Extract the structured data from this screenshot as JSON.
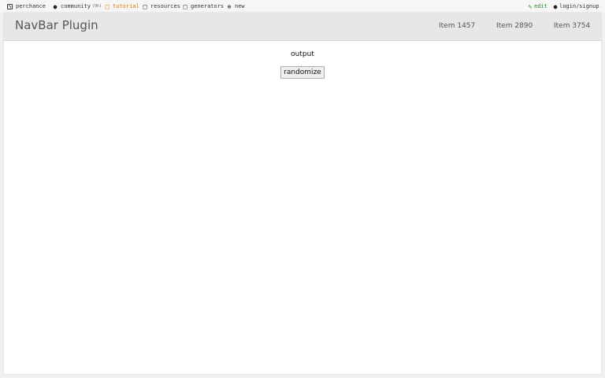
{
  "topbar": {
    "items": [
      {
        "icon": "die-icon",
        "label": "perchance"
      },
      {
        "icon": "people-icon",
        "label": "community",
        "badge": "(9h)"
      },
      {
        "icon": "book-icon",
        "label": "tutorial"
      },
      {
        "icon": "folder-icon",
        "label": "resources"
      },
      {
        "icon": "grid-icon",
        "label": "generators"
      },
      {
        "icon": "plus-circle-icon",
        "label": "new"
      }
    ],
    "edit_label": "edit",
    "login_label": "login/signup",
    "edit_icon": "pencil-icon",
    "login_icon": "user-icon"
  },
  "navbar": {
    "brand": "NavBar Plugin",
    "links": [
      "Item 1457",
      "Item 2890",
      "Item 3754"
    ]
  },
  "main": {
    "output": "output",
    "randomize_label": "randomize"
  },
  "colors": {
    "navbar_bg": "#e7e7e7",
    "tutorial_accent": "#e07800",
    "edit_accent": "#2a8a2a"
  }
}
